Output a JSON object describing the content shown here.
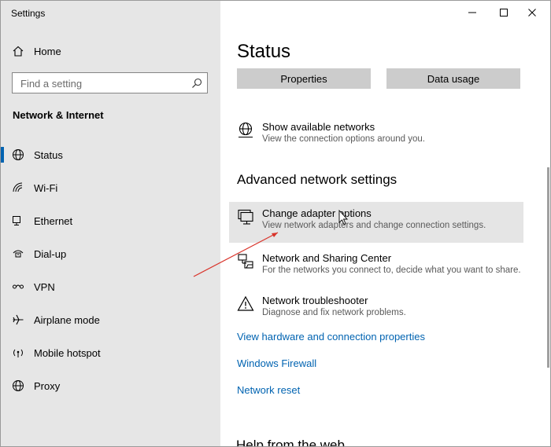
{
  "window": {
    "title": "Settings"
  },
  "sidebar": {
    "home_label": "Home",
    "search_placeholder": "Find a setting",
    "section_title": "Network & Internet",
    "items": [
      {
        "label": "Status",
        "icon": "globe-icon"
      },
      {
        "label": "Wi-Fi",
        "icon": "wifi-icon"
      },
      {
        "label": "Ethernet",
        "icon": "ethernet-icon"
      },
      {
        "label": "Dial-up",
        "icon": "dialup-icon"
      },
      {
        "label": "VPN",
        "icon": "vpn-icon"
      },
      {
        "label": "Airplane mode",
        "icon": "airplane-icon"
      },
      {
        "label": "Mobile hotspot",
        "icon": "hotspot-icon"
      },
      {
        "label": "Proxy",
        "icon": "globe-icon"
      }
    ]
  },
  "main": {
    "title": "Status",
    "buttons": {
      "properties": "Properties",
      "data_usage": "Data usage"
    },
    "show_networks": {
      "title": "Show available networks",
      "desc": "View the connection options around you."
    },
    "advanced_heading": "Advanced network settings",
    "change_adapter": {
      "title": "Change adapter options",
      "desc": "View network adapters and change connection settings."
    },
    "sharing_center": {
      "title": "Network and Sharing Center",
      "desc": "For the networks you connect to, decide what you want to share."
    },
    "troubleshooter": {
      "title": "Network troubleshooter",
      "desc": "Diagnose and fix network problems."
    },
    "links": {
      "hardware": "View hardware and connection properties",
      "firewall": "Windows Firewall",
      "reset": "Network reset"
    },
    "help_heading": "Help from the web"
  },
  "colors": {
    "accent": "#0063b1",
    "sidebar_bg": "#e6e6e6",
    "button_bg": "#cccccc",
    "annotation": "#d9342b"
  }
}
